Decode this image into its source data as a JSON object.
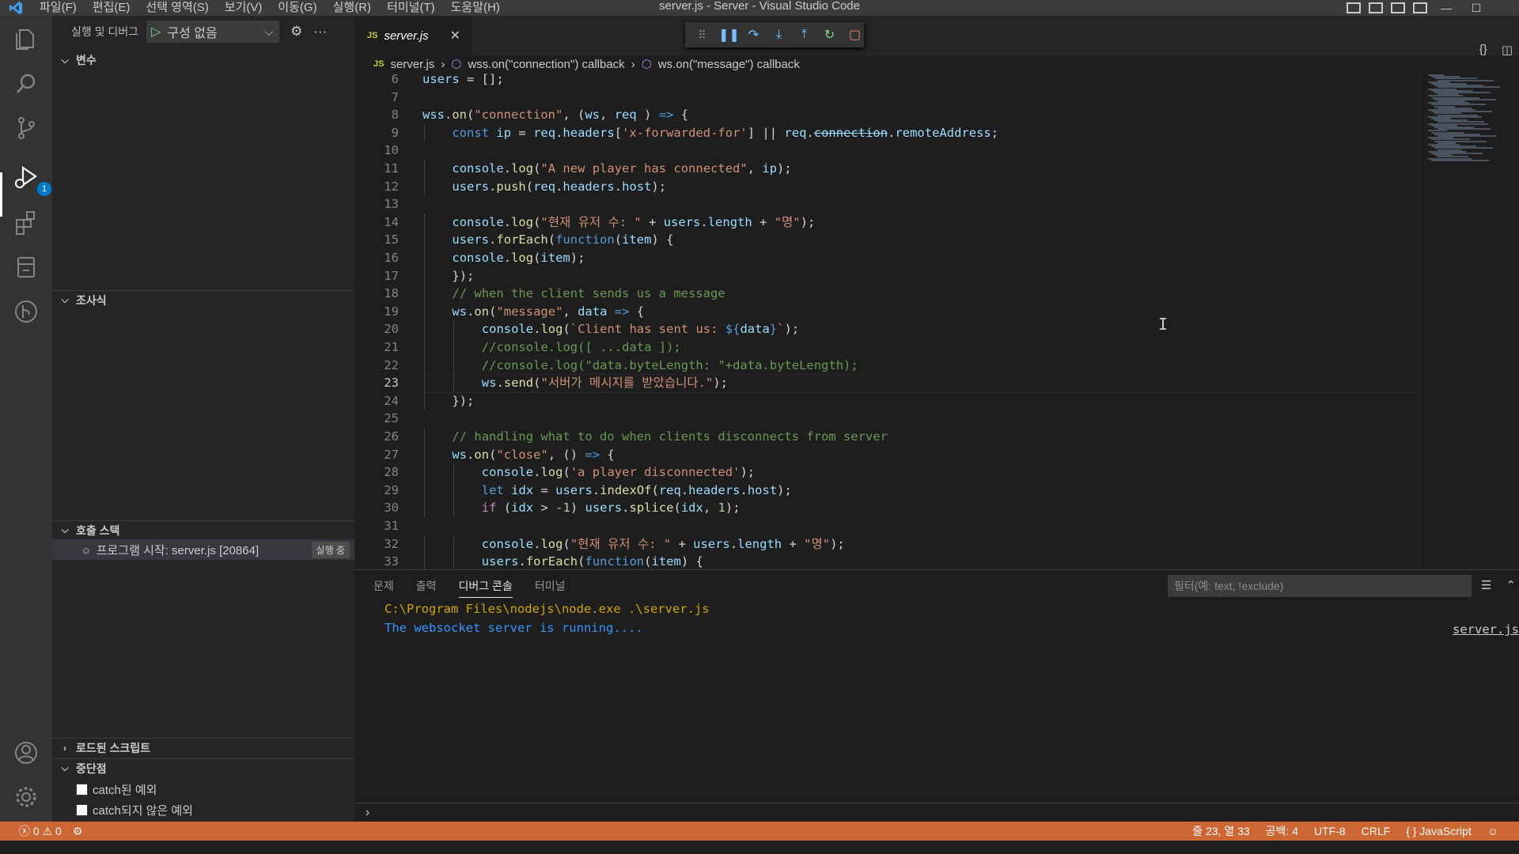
{
  "window": {
    "title": "server.js - Server - Visual Studio Code",
    "menus": [
      "파일(F)",
      "편집(E)",
      "선택 영역(S)",
      "보기(V)",
      "이동(G)",
      "실행(R)",
      "터미널(T)",
      "도움말(H)"
    ]
  },
  "activity_bar": {
    "items": [
      "files-icon",
      "search-icon",
      "source-control-icon",
      "run-debug-icon",
      "extensions-icon",
      "remote-explorer-icon",
      "git-graph-icon"
    ],
    "debug_badge": "1",
    "bottom": [
      "account-icon",
      "settings-gear-icon"
    ]
  },
  "sidebar": {
    "title": "실행 및 디버그",
    "run_config": "구성 없음",
    "sections": {
      "variables": "변수",
      "watch": "조사식",
      "callstack": "호출 스택",
      "loaded_scripts": "로드된 스크립트",
      "breakpoints": "중단점"
    },
    "callstack_item": {
      "label": "프로그램 시작: server.js [20864]",
      "state": "실행 중"
    },
    "breakpoints": [
      {
        "label": "catch된 예외",
        "checked": false
      },
      {
        "label": "catch되지 않은 예외",
        "checked": false
      }
    ]
  },
  "editor": {
    "tab": {
      "icon": "JS",
      "name": "server.js"
    },
    "breadcrumb": [
      "server.js",
      "wss.on(\"connection\") callback",
      "ws.on(\"message\") callback"
    ],
    "current_line": 23,
    "lines": [
      {
        "n": "6",
        "indent": 0,
        "html": "<span class='v'>users</span> = [];"
      },
      {
        "n": "7",
        "indent": 0,
        "html": ""
      },
      {
        "n": "8",
        "indent": 0,
        "html": "<span class='v'>wss</span>.<span class='f'>on</span>(<span class='s'>\"connection\"</span>, (<span class='v'>ws</span>, <span class='v'>req</span> ) <span class='k'>=&gt;</span> {"
      },
      {
        "n": "9",
        "indent": 1,
        "html": "<span class='k'>const</span> <span class='v'>ip</span> = <span class='v'>req</span>.<span class='v'>headers</span>[<span class='s'>'x-forwarded-for'</span>] || <span class='v'>req</span>.<span class='v strike'>connection</span>.<span class='v'>remoteAddress</span>;"
      },
      {
        "n": "10",
        "indent": 0,
        "html": ""
      },
      {
        "n": "11",
        "indent": 1,
        "html": "<span class='v'>console</span>.<span class='f'>log</span>(<span class='s'>\"A new player has connected\"</span>, <span class='v'>ip</span>);"
      },
      {
        "n": "12",
        "indent": 1,
        "html": "<span class='v'>users</span>.<span class='f'>push</span>(<span class='v'>req</span>.<span class='v'>headers</span>.<span class='v'>host</span>);"
      },
      {
        "n": "13",
        "indent": 0,
        "html": ""
      },
      {
        "n": "14",
        "indent": 1,
        "html": "<span class='v'>console</span>.<span class='f'>log</span>(<span class='s'>\"현재 유저 수: \"</span> + <span class='v'>users</span>.<span class='v'>length</span> + <span class='s'>\"명\"</span>);"
      },
      {
        "n": "15",
        "indent": 1,
        "html": "<span class='v'>users</span>.<span class='f'>forEach</span>(<span class='k'>function</span>(<span class='v'>item</span>) {"
      },
      {
        "n": "16",
        "indent": 1,
        "html": "<span class='v'>console</span>.<span class='f'>log</span>(<span class='v'>item</span>);"
      },
      {
        "n": "17",
        "indent": 1,
        "html": "});"
      },
      {
        "n": "18",
        "indent": 1,
        "html": "<span class='c'>// when the client sends us a message</span>"
      },
      {
        "n": "19",
        "indent": 1,
        "html": "<span class='v'>ws</span>.<span class='f'>on</span>(<span class='s'>\"message\"</span>, <span class='v'>data</span> <span class='k'>=&gt;</span> {"
      },
      {
        "n": "20",
        "indent": 2,
        "html": "<span class='v'>console</span>.<span class='f'>log</span>(<span class='s'>`Client has sent us: </span><span class='k'>${</span><span class='v'>data</span><span class='k'>}</span><span class='s'>`</span>);"
      },
      {
        "n": "21",
        "indent": 2,
        "html": "<span class='c'>//console.log([ ...data ]);</span>"
      },
      {
        "n": "22",
        "indent": 2,
        "html": "<span class='c'>//console.log(\"data.byteLength: \"+data.byteLength);</span>"
      },
      {
        "n": "23",
        "indent": 2,
        "html": "<span class='v'>ws</span>.<span class='f'>send</span>(<span class='s'>\"서버가 메시지를 받았습니다.\"</span>);"
      },
      {
        "n": "24",
        "indent": 1,
        "html": "});"
      },
      {
        "n": "25",
        "indent": 0,
        "html": ""
      },
      {
        "n": "26",
        "indent": 1,
        "html": "<span class='c'>// handling what to do when clients disconnects from server</span>"
      },
      {
        "n": "27",
        "indent": 1,
        "html": "<span class='v'>ws</span>.<span class='f'>on</span>(<span class='s'>\"close\"</span>, () <span class='k'>=&gt;</span> {"
      },
      {
        "n": "28",
        "indent": 2,
        "html": "<span class='v'>console</span>.<span class='f'>log</span>(<span class='s'>'a player disconnected'</span>);"
      },
      {
        "n": "29",
        "indent": 2,
        "html": "<span class='k'>let</span> <span class='v'>idx</span> = <span class='v'>users</span>.<span class='f'>indexOf</span>(<span class='v'>req</span>.<span class='v'>headers</span>.<span class='v'>host</span>);"
      },
      {
        "n": "30",
        "indent": 2,
        "html": "<span class='ctl'>if</span> (<span class='v'>idx</span> &gt; <span class='n'>-1</span>) <span class='v'>users</span>.<span class='f'>splice</span>(<span class='v'>idx</span>, <span class='n'>1</span>);"
      },
      {
        "n": "31",
        "indent": 0,
        "html": ""
      },
      {
        "n": "32",
        "indent": 2,
        "html": "<span class='v'>console</span>.<span class='f'>log</span>(<span class='s'>\"현재 유저 수: \"</span> + <span class='v'>users</span>.<span class='v'>length</span> + <span class='s'>\"명\"</span>);"
      },
      {
        "n": "33",
        "indent": 2,
        "html": "<span class='v'>users</span>.<span class='f'>forEach</span>(<span class='k'>function</span>(<span class='v'>item</span>) {"
      }
    ]
  },
  "panel": {
    "tabs": [
      "문제",
      "출력",
      "디버그 콘솔",
      "터미널"
    ],
    "active_tab": "디버그 콘솔",
    "filter_placeholder": "필터(예: text, !exclude)",
    "console": [
      "C:\\Program Files\\nodejs\\node.exe .\\server.js",
      "The websocket server is running...."
    ],
    "console_source": "server.js"
  },
  "statusbar": {
    "errors": "0",
    "warnings": "0",
    "position": "줄 23, 열 33",
    "spaces": "공백: 4",
    "encoding": "UTF-8",
    "eol": "CRLF",
    "language": "JavaScript",
    "color": "#cc6633"
  }
}
